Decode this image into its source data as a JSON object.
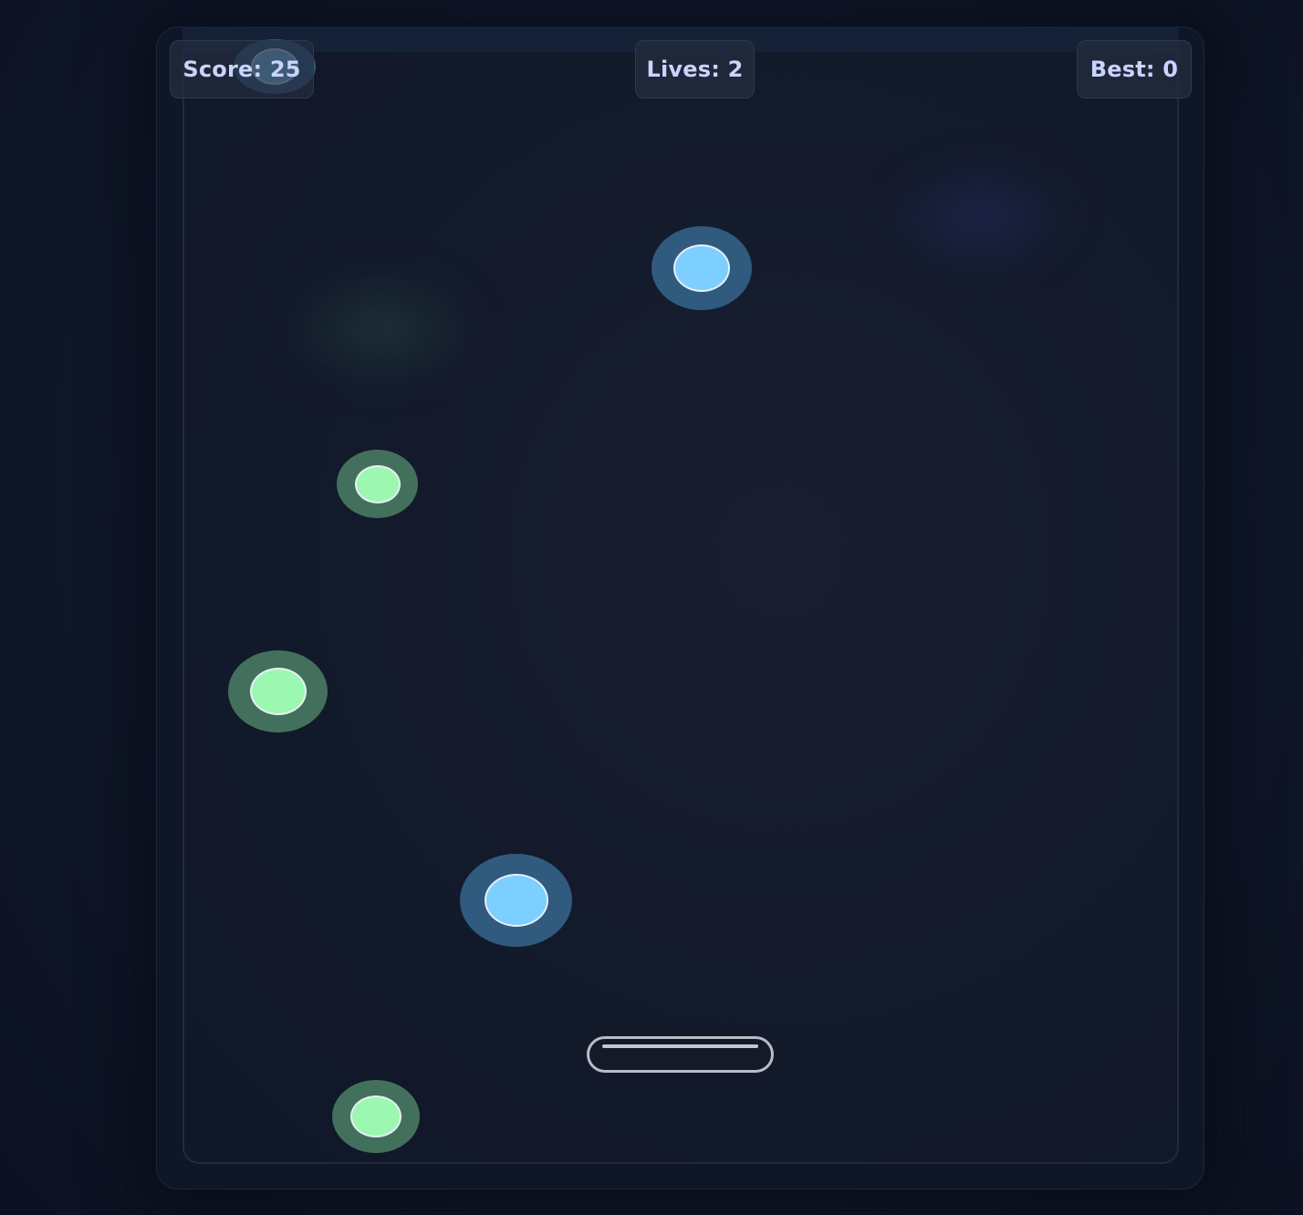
{
  "hud": {
    "score_label": "Score: 25",
    "lives_label": "Lives: 2",
    "best_label": "Best: 0"
  },
  "colors": {
    "hud_text": "#c9d4ff",
    "blue_ball_core": "#7ccfff",
    "blue_ball_halo": "#305a7e",
    "green_ball_core": "#9cf8b0",
    "green_ball_halo": "#43705c",
    "paddle_outline": "#b8bcc6",
    "background": "#111a2c"
  },
  "balls": [
    {
      "kind": "blue"
    },
    {
      "kind": "blue"
    },
    {
      "kind": "green"
    },
    {
      "kind": "green"
    },
    {
      "kind": "blue"
    },
    {
      "kind": "green"
    }
  ]
}
